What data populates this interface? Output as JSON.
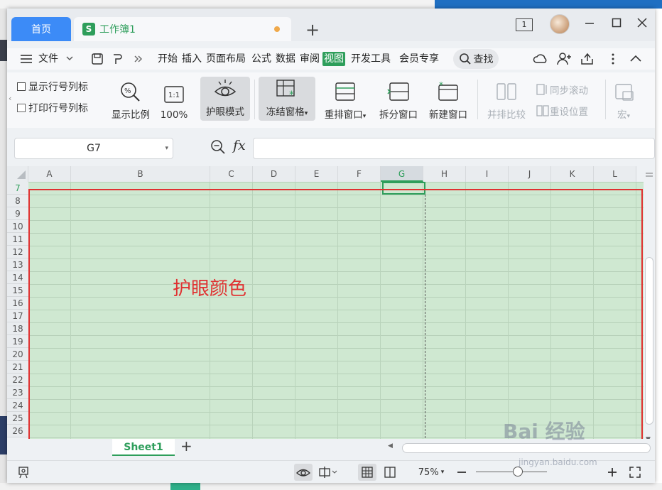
{
  "window": {
    "tabs": [
      {
        "label": "首页"
      },
      {
        "label": "工作簿1",
        "logo": "S"
      }
    ],
    "new_tab": "+",
    "badge": "1"
  },
  "menu": {
    "file_label": "文件",
    "items": [
      "开始",
      "插入",
      "页面布局",
      "公式",
      "数据",
      "审阅",
      "视图",
      "开发工具",
      "会员专享"
    ],
    "active": "视图",
    "search_label": "查找"
  },
  "toolbar": {
    "show_rowcol": "显示行号列标",
    "print_rowcol": "打印行号列标",
    "zoom_ratio": "显示比例",
    "zoom_100": "100%",
    "eye_mode": "护眼模式",
    "freeze": "冻结窗格",
    "rearrange": "重排窗口",
    "split": "拆分窗口",
    "new_window": "新建窗口",
    "side_by_side": "并排比较",
    "sync_scroll": "同步滚动",
    "reset_pos": "重设位置",
    "macro": "宏",
    "one_to_one": "1:1"
  },
  "formula_bar": {
    "cell_ref": "G7",
    "fx": "fx",
    "value": ""
  },
  "sheet": {
    "columns": [
      "A",
      "B",
      "C",
      "D",
      "E",
      "F",
      "G",
      "H",
      "I",
      "J",
      "K",
      "L"
    ],
    "rows": [
      "7",
      "8",
      "9",
      "10",
      "11",
      "12",
      "13",
      "14",
      "15",
      "16",
      "17",
      "18",
      "19",
      "20",
      "21",
      "22",
      "23",
      "24",
      "25",
      "26"
    ],
    "selected_col": "G",
    "selected_row": "7",
    "annotation": "护眼颜色",
    "tab_name": "Sheet1",
    "grid_color": "#cfe8d1",
    "annotation_color": "#e03131"
  },
  "status": {
    "zoom": "75%"
  },
  "watermark": {
    "text": "Bai 经验",
    "url": "jingyan.baidu.com"
  }
}
